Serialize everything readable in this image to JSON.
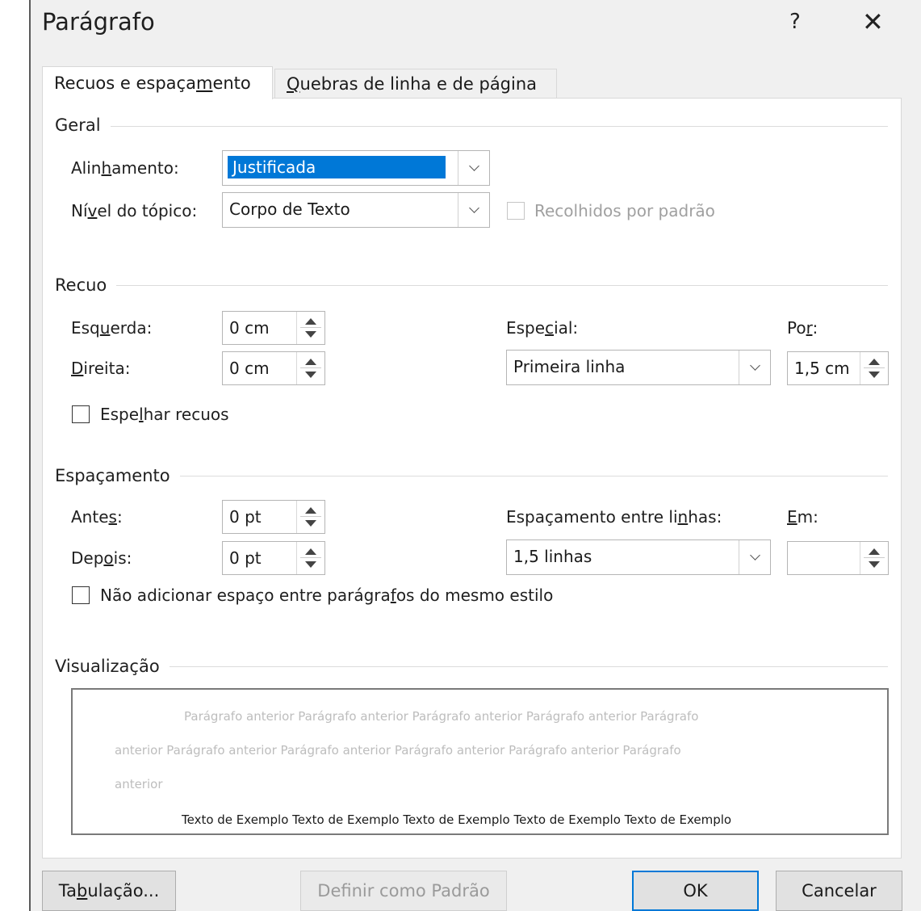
{
  "dialog": {
    "title": "Parágrafo",
    "help_label": "?",
    "close_glyph": "✕"
  },
  "tabs": [
    {
      "label_pre": "Recuos e espaça",
      "label_u": "m",
      "label_post": "ento",
      "active": true
    },
    {
      "label_pre": "",
      "label_u": "Q",
      "label_post": "uebras de linha e de página",
      "active": false
    }
  ],
  "geral": {
    "title": "Geral",
    "alignment": {
      "label_pre": "Alin",
      "label_u": "h",
      "label_post": "amento:",
      "value": "Justificada"
    },
    "outline": {
      "label_pre": "Ní",
      "label_u": "v",
      "label_post": "el do tópico:",
      "value": "Corpo de Texto"
    },
    "collapsed": {
      "label": "Recolhidos por padrão",
      "checked": false,
      "disabled": true
    }
  },
  "recuo": {
    "title": "Recuo",
    "left": {
      "label_pre": "Esq",
      "label_u": "u",
      "label_post": "erda:",
      "value": "0 cm"
    },
    "right": {
      "label_pre": "",
      "label_u": "D",
      "label_post": "ireita:",
      "value": "0 cm"
    },
    "special": {
      "label_pre": "Espe",
      "label_u": "c",
      "label_post": "ial:",
      "value": "Primeira linha"
    },
    "by": {
      "label_pre": "Po",
      "label_u": "r",
      "label_post": ":",
      "value": "1,5 cm"
    },
    "mirror": {
      "label_pre": "Espe",
      "label_u": "l",
      "label_post": "har recuos",
      "checked": false
    }
  },
  "espacamento": {
    "title": "Espaçamento",
    "before": {
      "label_pre": "Ante",
      "label_u": "s",
      "label_post": ":",
      "value": "0 pt"
    },
    "after": {
      "label_pre": "Dep",
      "label_u": "o",
      "label_post": "is:",
      "value": "0 pt"
    },
    "line": {
      "label_pre": "Espaçamento entre li",
      "label_u": "n",
      "label_post": "has:",
      "value": "1,5 linhas"
    },
    "at": {
      "label_pre": "",
      "label_u": "E",
      "label_post": "m:",
      "value": ""
    },
    "dont_add": {
      "label_pre": "Não adicionar espaço entre parágra",
      "label_u": "f",
      "label_post": "os do mesmo estilo",
      "checked": false
    }
  },
  "visualizacao": {
    "title": "Visualização",
    "prev_lines": [
      "Parágrafo anterior  Parágrafo anterior  Parágrafo anterior  Parágrafo anterior  Parágrafo",
      "anterior  Parágrafo anterior  Parágrafo anterior  Parágrafo anterior  Parágrafo anterior  Parágrafo",
      "anterior"
    ],
    "sample": "Texto de Exemplo Texto de Exemplo Texto de Exemplo Texto de Exemplo Texto de Exemplo"
  },
  "buttons": {
    "tabs": {
      "label_pre": "Ta",
      "label_u": "b",
      "label_post": "ulação..."
    },
    "default": {
      "label": "Definir como Padrão"
    },
    "ok": {
      "label": "OK"
    },
    "cancel": {
      "label": "Cancelar"
    }
  }
}
